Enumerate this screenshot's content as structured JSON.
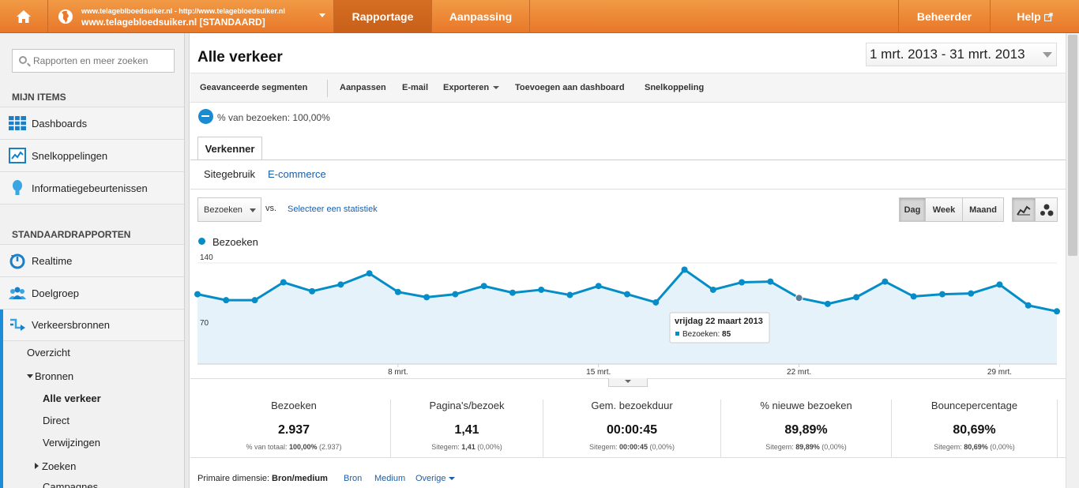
{
  "topbar": {
    "account_line1": "www.telageblboedsuiker.nl - http://www.telagebloedsuiker.nl",
    "account_line2": "www.telagebloedsuiker.nl [STANDAARD]",
    "tabs": [
      "Rapportage",
      "Aanpassing"
    ],
    "right_tabs": [
      "Beheerder",
      "Help"
    ]
  },
  "sidebar": {
    "search_placeholder": "Rapporten en meer zoeken",
    "section_mijn": "MIJN ITEMS",
    "mijn_items": [
      "Dashboards",
      "Snelkoppelingen",
      "Informatiegebeurtenissen"
    ],
    "section_standaard": "STANDAARDRAPPORTEN",
    "standaard_items": [
      "Realtime",
      "Doelgroep",
      "Verkeersbronnen"
    ],
    "sub_items": [
      "Overzicht",
      "Bronnen",
      "Alle verkeer",
      "Direct",
      "Verwijzingen",
      "Zoeken",
      "Campagnes"
    ]
  },
  "main": {
    "title": "Alle verkeer",
    "daterange": "1 mrt. 2013 - 31 mrt. 2013",
    "toolbar": [
      "Geavanceerde segmenten",
      "Aanpassen",
      "E-mail",
      "Exporteren",
      "Toevoegen aan dashboard",
      "Snelkoppeling"
    ],
    "segment": "% van bezoeken: 100,00%",
    "tab": "Verkenner",
    "subtabs": [
      "Sitegebruik",
      "E-commerce"
    ],
    "metric_dropdown": "Bezoeken",
    "vs": "vs.",
    "select_stat": "Selecteer een statistiek",
    "period_buttons": [
      "Dag",
      "Week",
      "Maand"
    ],
    "legend": "Bezoeken"
  },
  "chart_data": {
    "type": "area",
    "series": [
      {
        "name": "Bezoeken",
        "values": [
          98,
          90,
          90,
          114,
          102,
          111,
          126,
          101,
          94,
          98,
          109,
          100,
          104,
          97,
          109,
          98,
          87,
          131,
          104,
          114,
          115,
          93,
          85,
          94,
          115,
          95,
          98,
          99,
          111,
          83,
          75
        ]
      }
    ],
    "x_labels": [
      "8 mrt.",
      "15 mrt.",
      "22 mrt.",
      "29 mrt."
    ],
    "y_ticks": [
      "140",
      "70"
    ],
    "ylim": [
      0,
      140
    ],
    "color": "#058dc7",
    "tooltip": {
      "title": "vrijdag 22 maart 2013",
      "label": "Bezoeken:",
      "value": "85"
    }
  },
  "stats": [
    {
      "label": "Bezoeken",
      "value": "2.937",
      "sub_label": "% van totaal:",
      "sub_value": "100,00%",
      "sub_extra": "(2.937)"
    },
    {
      "label": "Pagina's/bezoek",
      "value": "1,41",
      "sub_label": "Sitegem:",
      "sub_value": "1,41",
      "sub_extra": "(0,00%)"
    },
    {
      "label": "Gem. bezoekduur",
      "value": "00:00:45",
      "sub_label": "Sitegem:",
      "sub_value": "00:00:45",
      "sub_extra": "(0,00%)"
    },
    {
      "label": "% nieuwe bezoeken",
      "value": "89,89%",
      "sub_label": "Sitegem:",
      "sub_value": "89,89%",
      "sub_extra": "(0,00%)"
    },
    {
      "label": "Bouncepercentage",
      "value": "80,69%",
      "sub_label": "Sitegem:",
      "sub_value": "80,69%",
      "sub_extra": "(0,00%)"
    }
  ],
  "primary_dimension": {
    "label": "Primaire dimensie:",
    "current": "Bron/medium",
    "options": [
      "Bron",
      "Medium",
      "Overige"
    ]
  }
}
